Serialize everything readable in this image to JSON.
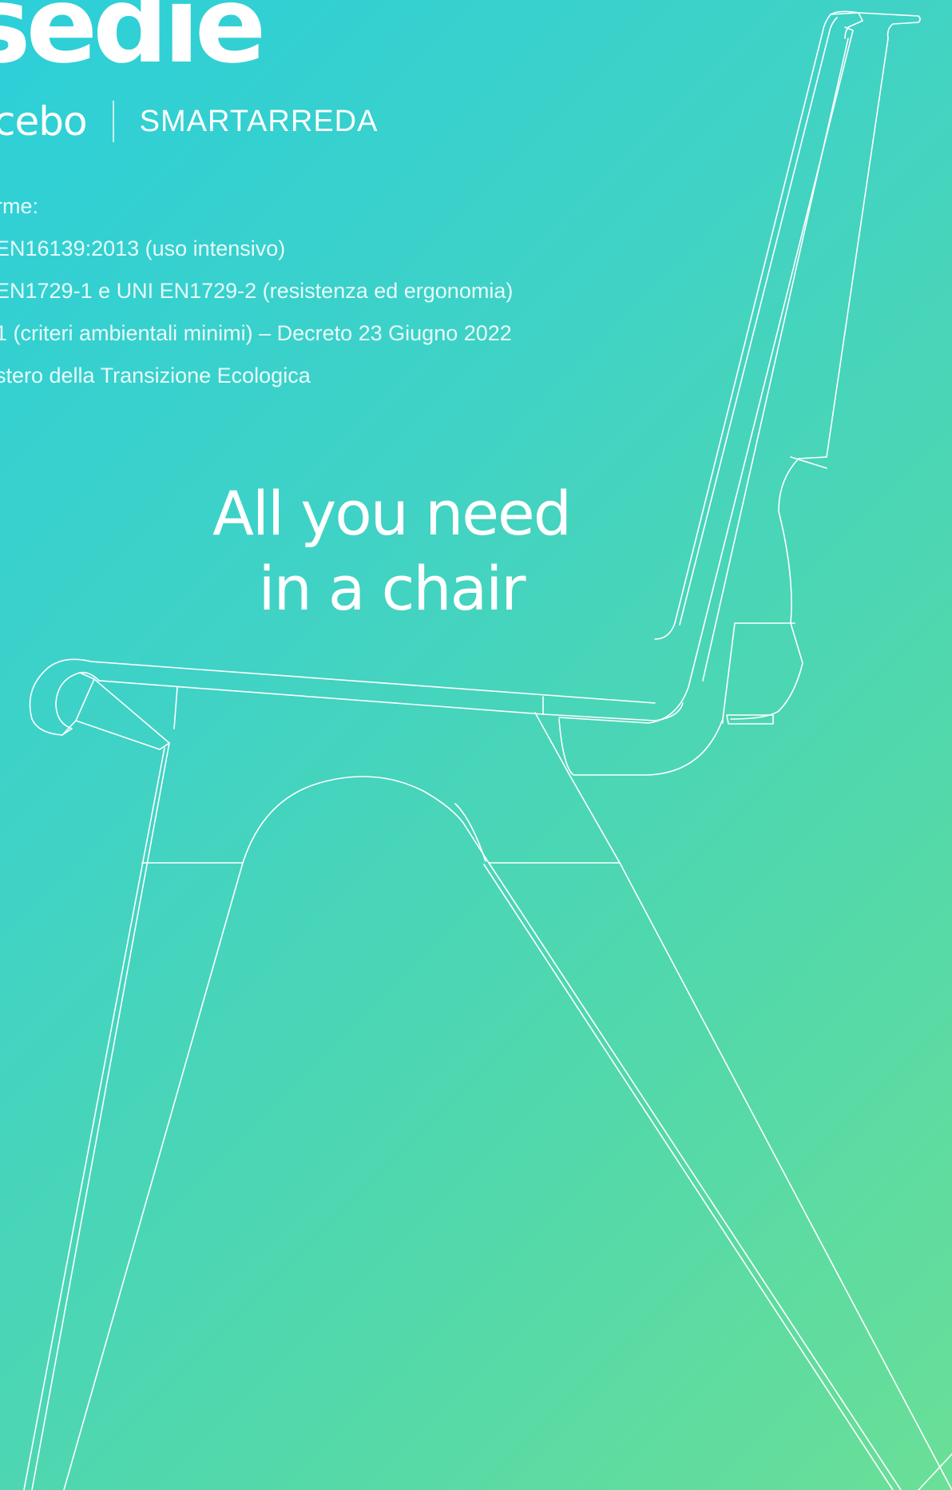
{
  "page": {
    "background_colors": [
      "#2ccfd9",
      "#3fd2c6",
      "#52d8aa",
      "#6adf97"
    ],
    "text_color": "#ffffff"
  },
  "header": {
    "title": "sedie",
    "brand_primary": "cebo",
    "brand_secondary": "SMARTARREDA"
  },
  "norms": {
    "items": [
      "rme:",
      "EN16139:2013 (uso intensivo)",
      "EN1729-1 e UNI EN1729-2 (resistenza ed ergonomia)",
      "1 (criteri ambientali minimi) – Decreto 23 Giugno 2022",
      "stero della Transizione Ecologica"
    ]
  },
  "tagline": {
    "line1": "All you need",
    "line2": "in a chair"
  },
  "illustration": {
    "icon": "chair-line-drawing-icon",
    "stroke_color": "#ffffff"
  }
}
